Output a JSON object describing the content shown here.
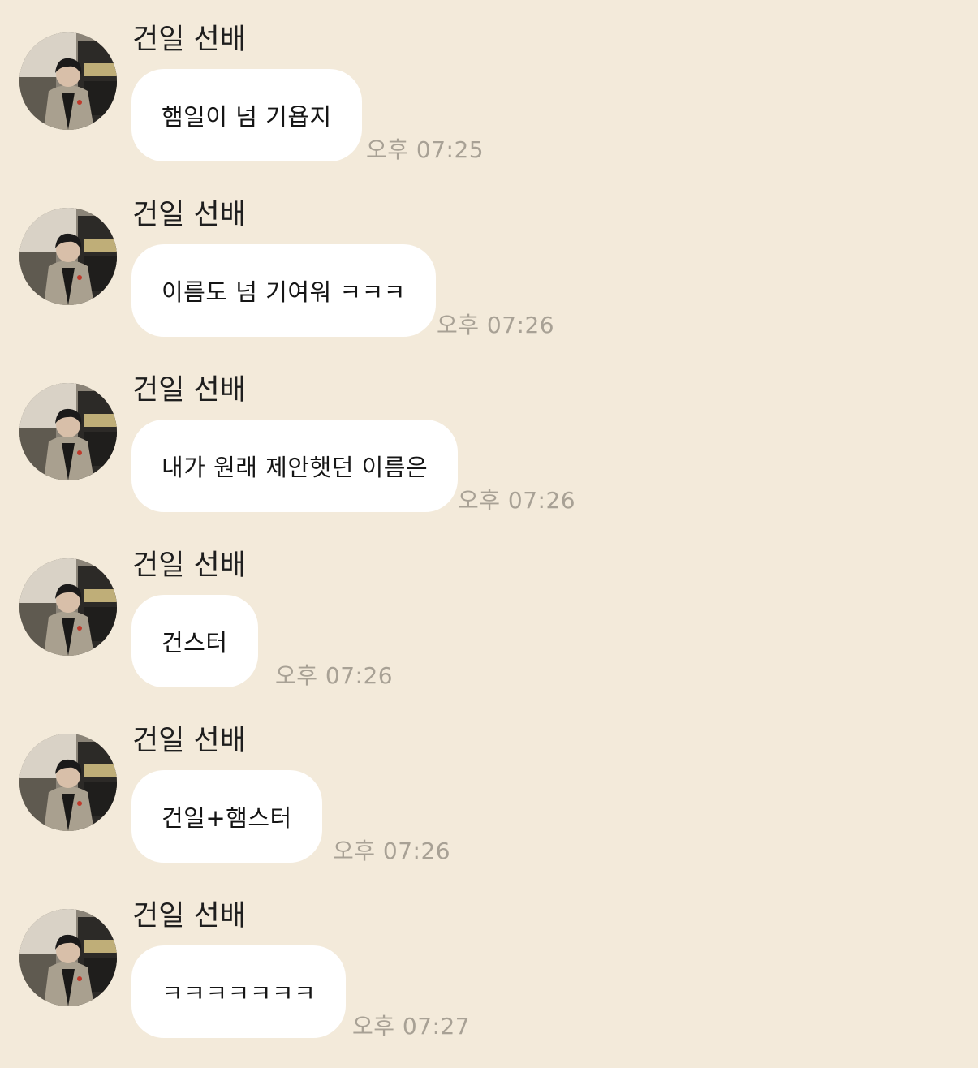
{
  "messages": [
    {
      "sender": "건일 선배",
      "text": "햄일이 넘 기욥지",
      "time": "오후 07:25"
    },
    {
      "sender": "건일 선배",
      "text": "이름도 넘 기여워 ㅋㅋㅋ",
      "time": "오후 07:26"
    },
    {
      "sender": "건일 선배",
      "text": "내가 원래 제안햇던 이름은",
      "time": "오후 07:26"
    },
    {
      "sender": "건일 선배",
      "text": "건스터",
      "time": "오후 07:26"
    },
    {
      "sender": "건일 선배",
      "text": "건일+햄스터",
      "time": "오후 07:26"
    },
    {
      "sender": "건일 선배",
      "text": "ㅋㅋㅋㅋㅋㅋㅋ",
      "time": "오후 07:27"
    }
  ]
}
